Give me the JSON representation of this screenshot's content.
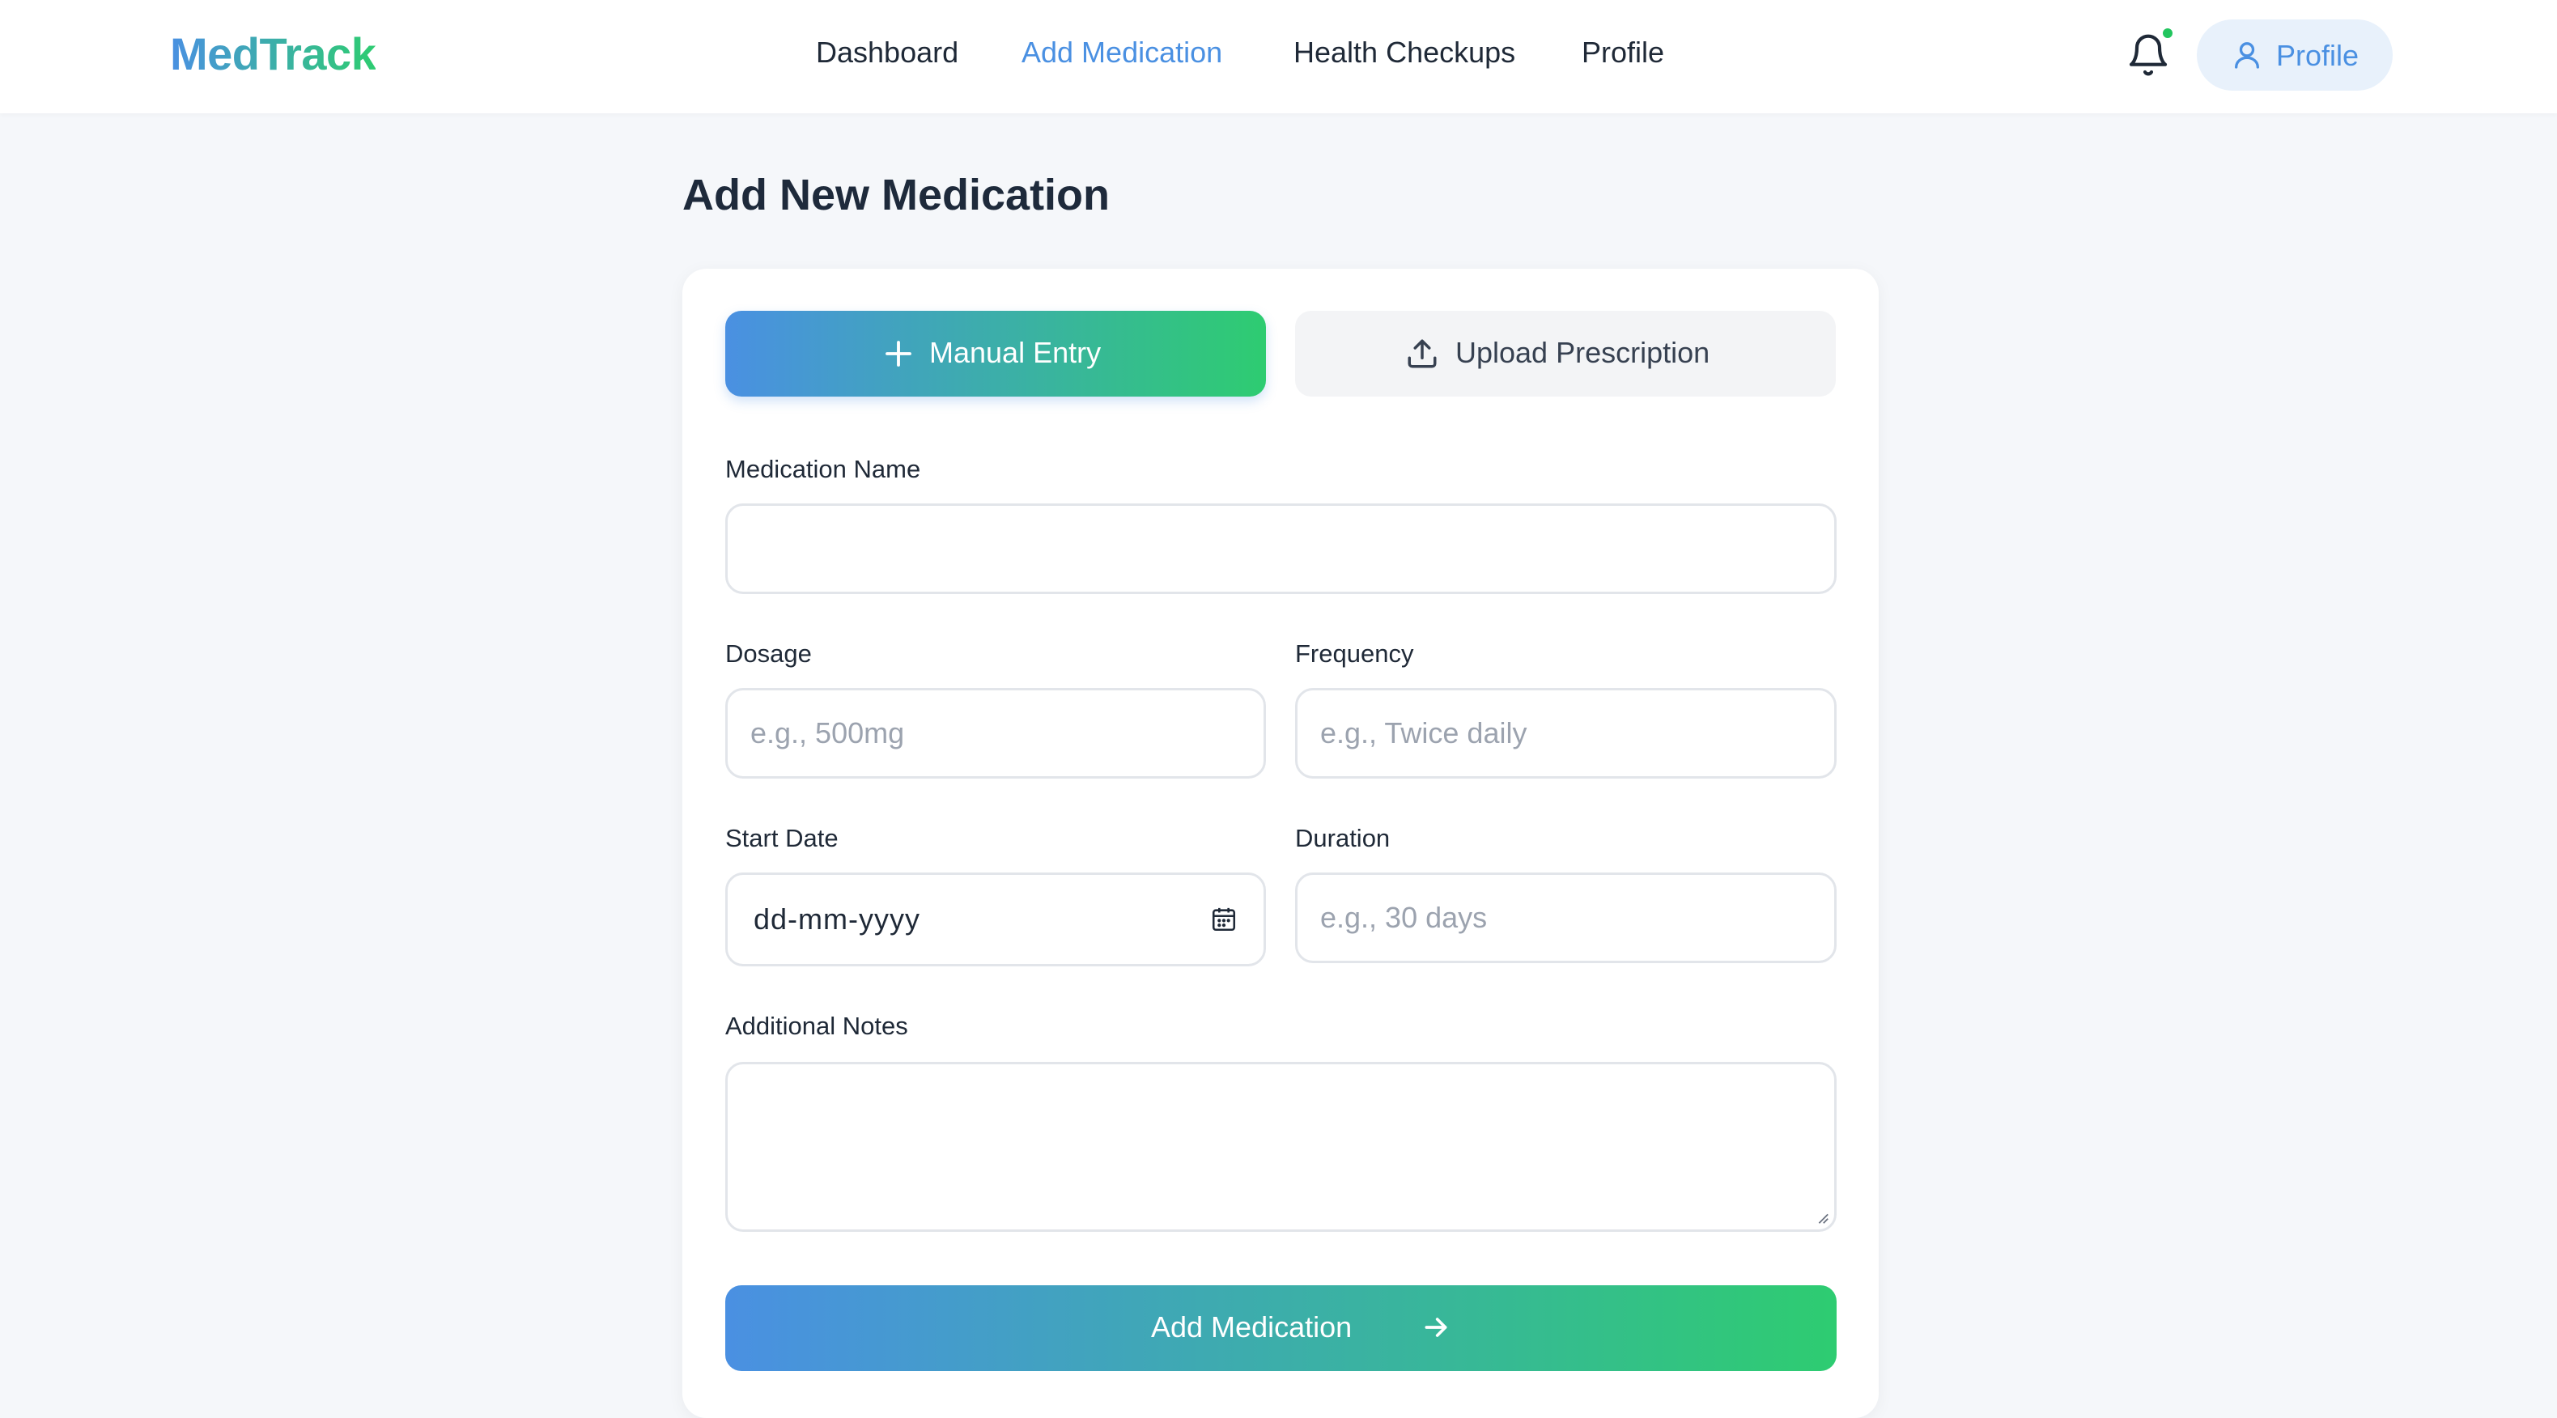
{
  "app": {
    "logo": "MedTrack",
    "brand_gradient": [
      "#4a90e2",
      "#2ecc71"
    ],
    "accent_color": "#4a90e2",
    "notification_dot_color": "#22c55e"
  },
  "nav": {
    "links": [
      {
        "label": "Dashboard",
        "active": false
      },
      {
        "label": "Add Medication",
        "active": true
      },
      {
        "label": "Health Checkups",
        "active": false
      },
      {
        "label": "Profile",
        "active": false
      }
    ],
    "bell_icon": "bell-icon",
    "profile_button": {
      "label": "Profile",
      "icon": "user-icon"
    }
  },
  "page": {
    "title": "Add New Medication"
  },
  "form": {
    "tabs": [
      {
        "label": "Manual Entry",
        "icon": "plus-icon",
        "selected": true
      },
      {
        "label": "Upload Prescription",
        "icon": "upload-icon",
        "selected": false
      }
    ],
    "fields": {
      "medication_name": {
        "label": "Medication Name",
        "placeholder": "",
        "value": ""
      },
      "dosage": {
        "label": "Dosage",
        "placeholder": "e.g., 500mg",
        "value": ""
      },
      "frequency": {
        "label": "Frequency",
        "placeholder": "e.g., Twice daily",
        "value": ""
      },
      "start_date": {
        "label": "Start Date",
        "placeholder": "dd-mm-yyyy",
        "value": "",
        "icon": "calendar-icon"
      },
      "duration": {
        "label": "Duration",
        "placeholder": "e.g., 30 days",
        "value": ""
      },
      "notes": {
        "label": "Additional Notes",
        "value": ""
      }
    },
    "submit": {
      "label": "Add Medication",
      "icon": "arrow-right-icon"
    }
  }
}
